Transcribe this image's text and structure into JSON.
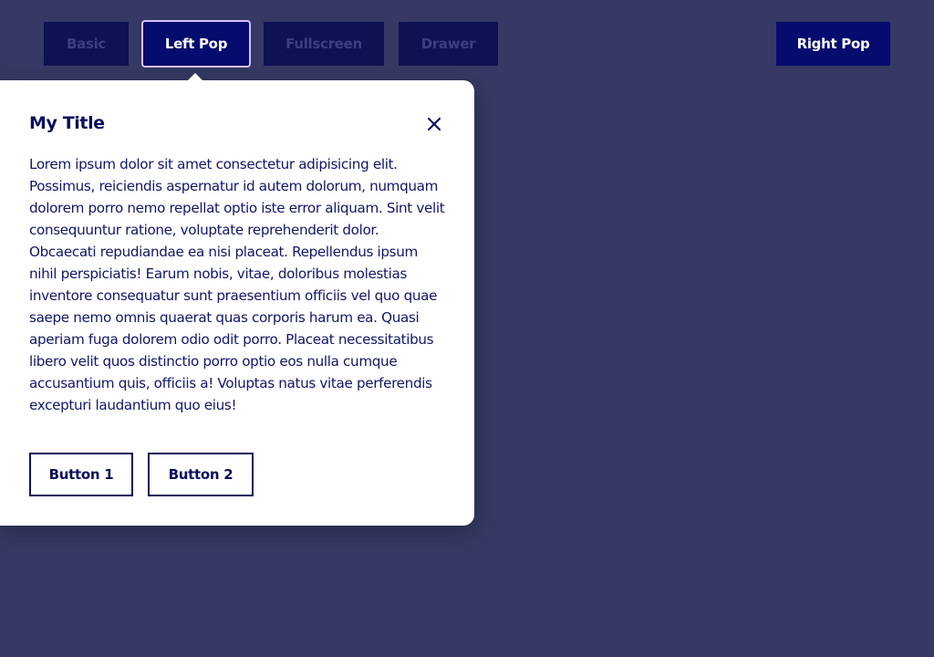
{
  "toolbar": {
    "buttons": [
      {
        "label": "Basic",
        "state": "inactive"
      },
      {
        "label": "Left Pop",
        "state": "active"
      },
      {
        "label": "Fullscreen",
        "state": "inactive"
      },
      {
        "label": "Drawer",
        "state": "inactive"
      },
      {
        "label": "Right Pop",
        "state": "enabled"
      }
    ]
  },
  "popover": {
    "title": "My Title",
    "close_icon": "close-icon",
    "body": "Lorem ipsum dolor sit amet consectetur adipisicing elit. Possimus, reiciendis aspernatur id autem dolorum, numquam dolorem porro nemo repellat optio iste error aliquam. Sint velit consequuntur ratione, voluptate reprehenderit dolor. Obcaecati repudiandae ea nisi placeat. Repellendus ipsum nihil perspiciatis! Earum nobis, vitae, doloribus molestias inventore consequatur sunt praesentium officiis vel quo quae saepe nemo omnis quaerat quas corporis harum ea. Quasi aperiam fuga dolorem odio odit porro. Placeat necessitatibus libero velit quos distinctio porro optio eos nulla cumque accusantium quis, officiis a! Voluptas natus vitae perferendis excepturi laudantium quo eius!",
    "buttons": [
      {
        "label": "Button 1"
      },
      {
        "label": "Button 2"
      }
    ]
  },
  "colors": {
    "background": "#353963",
    "accent": "#060b6e",
    "text": "#0b0f5c",
    "inactive_button": "#0e1152"
  }
}
